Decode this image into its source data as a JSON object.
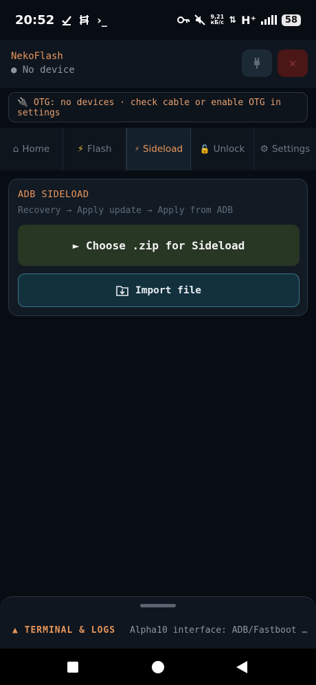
{
  "status_bar": {
    "time": "20:52",
    "net_speed_value": "9,21",
    "net_speed_unit": "кБ/с",
    "network": "H⁺",
    "battery": "58",
    "terminal_glyph": "›_"
  },
  "header": {
    "title": "NekoFlash",
    "device_status": "● No device"
  },
  "otg_banner": {
    "text": "🔌 OTG: no devices · check cable or enable OTG in settings"
  },
  "tabs": [
    {
      "icon": "⌂",
      "label": "Home"
    },
    {
      "icon": "⚡",
      "label": "Flash"
    },
    {
      "icon": "⚡",
      "label": "Sideload"
    },
    {
      "icon": "🔓",
      "label": "Unlock"
    },
    {
      "icon": "⚙",
      "label": "Settings"
    }
  ],
  "active_tab": "Sideload",
  "sideload_card": {
    "title": "ADB SIDELOAD",
    "subtitle": "Recovery → Apply update → Apply from ADB",
    "choose_button": "► Choose .zip for Sideload",
    "import_button": "Import file"
  },
  "terminal": {
    "title": "▲ TERMINAL & LOGS",
    "log_preview": "Alpha10 interface: ADB/Fastboot t…"
  },
  "colors": {
    "accent": "#e8955a",
    "background": "#080d14",
    "choose_button_bg": "#283624",
    "import_button_bg": "#13303d"
  }
}
